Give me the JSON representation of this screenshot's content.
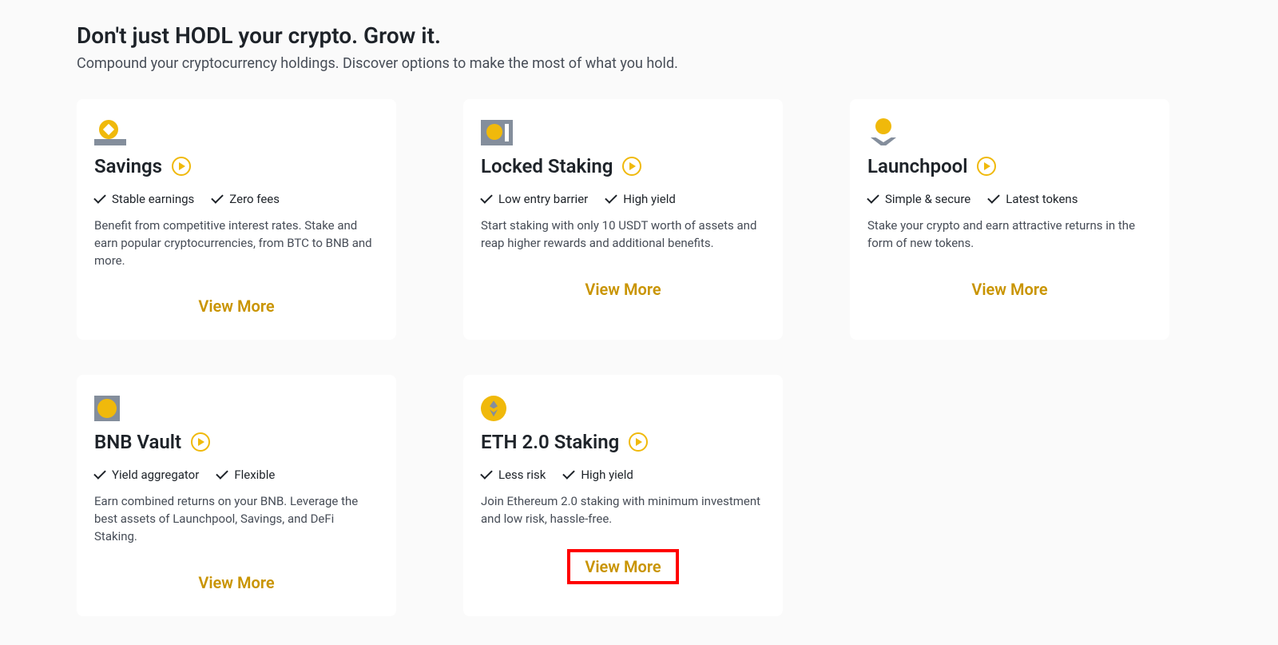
{
  "heading": "Don't just HODL your crypto. Grow it.",
  "subheading": "Compound your cryptocurrency holdings. Discover options to make the most of what you hold.",
  "view_more_label": "View More",
  "cards": [
    {
      "title": "Savings",
      "feat1": "Stable earnings",
      "feat2": "Zero fees",
      "desc": "Benefit from competitive interest rates. Stake and earn popular cryptocurrencies, from BTC to BNB and more."
    },
    {
      "title": "Locked Staking",
      "feat1": "Low entry barrier",
      "feat2": "High yield",
      "desc": "Start staking with only 10 USDT worth of assets and reap higher rewards and additional benefits."
    },
    {
      "title": "Launchpool",
      "feat1": "Simple & secure",
      "feat2": "Latest tokens",
      "desc": "Stake your crypto and earn attractive returns in the form of new tokens."
    },
    {
      "title": "BNB Vault",
      "feat1": "Yield aggregator",
      "feat2": "Flexible",
      "desc": "Earn combined returns on your BNB. Leverage the best assets of Launchpool, Savings, and DeFi Staking."
    },
    {
      "title": "ETH 2.0 Staking",
      "feat1": "Less risk",
      "feat2": "High yield",
      "desc": "Join Ethereum 2.0 staking with minimum investment and low risk, hassle-free."
    }
  ]
}
